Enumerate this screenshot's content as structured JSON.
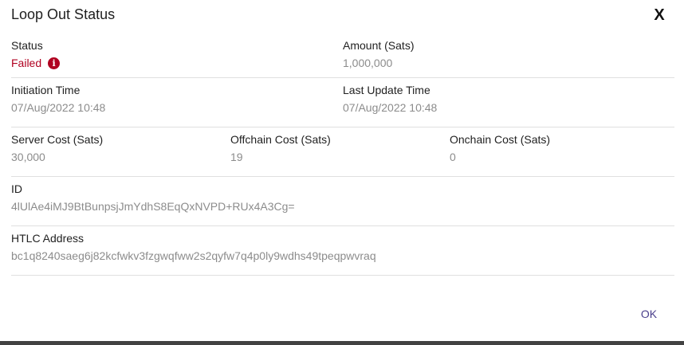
{
  "dialog": {
    "title": "Loop Out Status",
    "close_label": "X",
    "ok_label": "OK"
  },
  "fields": {
    "status": {
      "label": "Status",
      "value": "Failed",
      "icon": "info-icon"
    },
    "amount": {
      "label": "Amount (Sats)",
      "value": "1,000,000"
    },
    "initiation_time": {
      "label": "Initiation Time",
      "value": "07/Aug/2022 10:48"
    },
    "last_update_time": {
      "label": "Last Update Time",
      "value": "07/Aug/2022 10:48"
    },
    "server_cost": {
      "label": "Server Cost (Sats)",
      "value": "30,000"
    },
    "offchain_cost": {
      "label": "Offchain Cost (Sats)",
      "value": "19"
    },
    "onchain_cost": {
      "label": "Onchain Cost (Sats)",
      "value": "0"
    },
    "id": {
      "label": "ID",
      "value": "4lUlAe4iMJ9BtBunpsjJmYdhS8EqQxNVPD+RUx4A3Cg="
    },
    "htlc_address": {
      "label": "HTLC Address",
      "value": "bc1q8240saeg6j82kcfwkv3fzgwqfww2s2qyfw7q4p0ly9wdhs49tpeqpwvraq"
    }
  },
  "colors": {
    "failed": "#b00020",
    "accent": "#4a3f8c",
    "value_text": "#8c8c8c"
  }
}
